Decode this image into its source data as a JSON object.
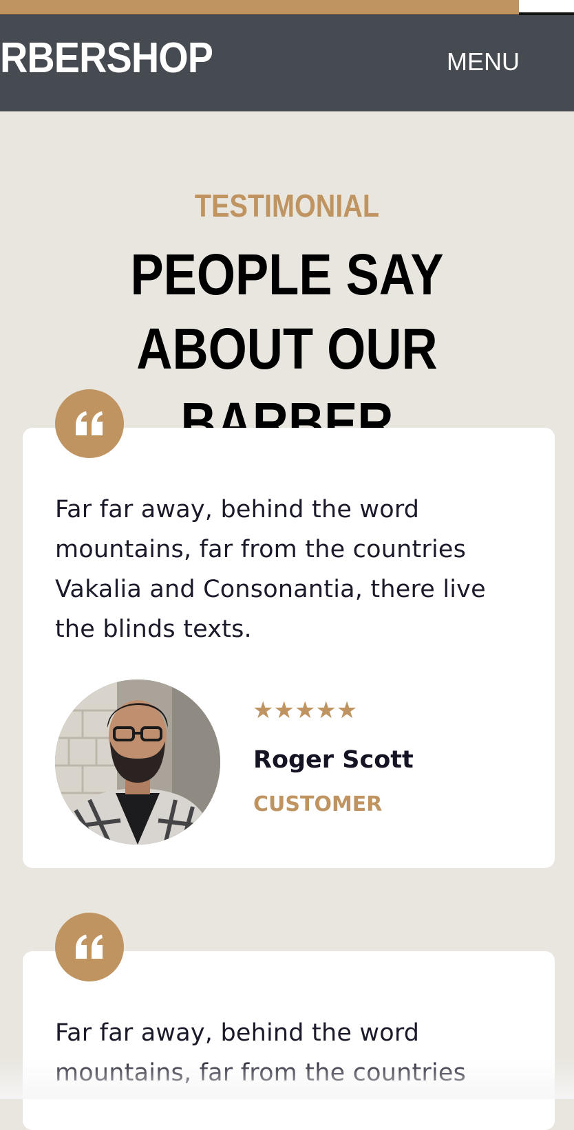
{
  "header": {
    "brand": "RBERSHOP",
    "menu_label": "MENU"
  },
  "section": {
    "eyebrow": "TESTIMONIAL",
    "heading_line1": "PEOPLE SAY",
    "heading_line2": "ABOUT OUR BARBER"
  },
  "testimonials": [
    {
      "quote_icon": "quote-icon",
      "text_lines": [
        "Far far away, behind the word",
        "mountains, far from the countries",
        "Vakalia and Consonantia, there live",
        "the blinds texts."
      ],
      "stars": "★★★★★",
      "rating": 5,
      "name": "Roger Scott",
      "role": "CUSTOMER"
    },
    {
      "quote_icon": "quote-icon",
      "text_lines": [
        "Far far away, behind the word",
        "mountains, far from the countries"
      ]
    }
  ],
  "colors": {
    "accent": "#bf9461",
    "nav_bg": "#464a51",
    "page_bg": "#e9e6df",
    "card_bg": "#ffffff",
    "text_dark": "#1a1a2a"
  }
}
